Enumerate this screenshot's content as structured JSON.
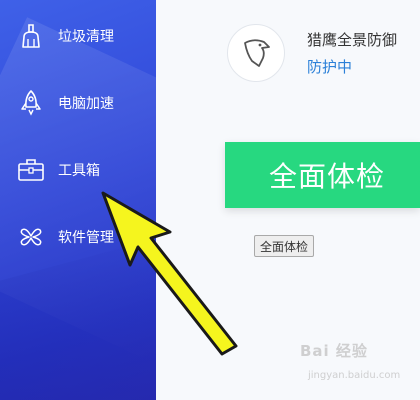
{
  "sidebar": {
    "items": [
      {
        "label": "垃圾清理",
        "icon": "broom-icon"
      },
      {
        "label": "电脑加速",
        "icon": "rocket-icon"
      },
      {
        "label": "工具箱",
        "icon": "toolbox-icon"
      },
      {
        "label": "软件管理",
        "icon": "software-manager-icon"
      }
    ]
  },
  "header": {
    "product_name": "猎鹰全景防御",
    "status": "防护中",
    "logo_icon": "eagle-icon"
  },
  "main": {
    "check_button_label": "全面体检",
    "small_button_label": "全面体检"
  },
  "annotation": {
    "icon": "yellow-arrow-icon",
    "color": "#f5f51e"
  },
  "watermark": {
    "text": "Bai 经验",
    "subtext": "jingyan.baidu.com"
  },
  "colors": {
    "sidebar": "#3047d8",
    "accent_green": "#27d880",
    "status_blue": "#2b80d8"
  }
}
